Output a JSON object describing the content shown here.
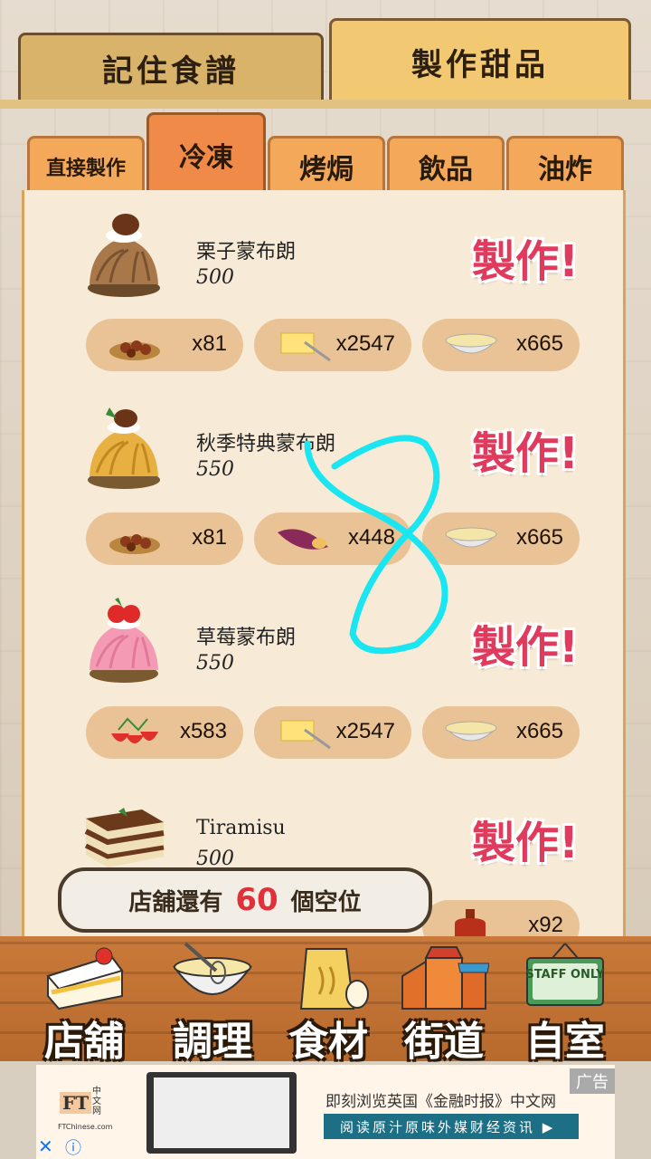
{
  "top_tabs": {
    "left": "記住食譜",
    "right": "製作甜品"
  },
  "category_tabs": [
    "直接製作",
    "冷凍",
    "烤焗",
    "飲品",
    "油炸"
  ],
  "recipes": [
    {
      "name": "栗子蒙布朗",
      "price": "500",
      "make_label": "製作!",
      "ingredients": [
        {
          "icon": "chestnut-icon",
          "count": "x81"
        },
        {
          "icon": "butter-icon",
          "count": "x2547"
        },
        {
          "icon": "cream-bowl-icon",
          "count": "x665"
        }
      ]
    },
    {
      "name": "秋季特典蒙布朗",
      "price": "550",
      "make_label": "製作!",
      "ingredients": [
        {
          "icon": "chestnut-icon",
          "count": "x81"
        },
        {
          "icon": "sweet-potato-icon",
          "count": "x448"
        },
        {
          "icon": "cream-bowl-icon",
          "count": "x665"
        }
      ]
    },
    {
      "name": "草莓蒙布朗",
      "price": "550",
      "make_label": "製作!",
      "ingredients": [
        {
          "icon": "strawberry-icon",
          "count": "x583"
        },
        {
          "icon": "butter-icon",
          "count": "x2547"
        },
        {
          "icon": "cream-bowl-icon",
          "count": "x665"
        }
      ]
    },
    {
      "name": "Tiramisu",
      "price": "500",
      "make_label": "製作!",
      "ingredients": [
        {
          "icon": "liquor-bottle-icon",
          "count": "x92"
        }
      ]
    }
  ],
  "seat_notice": {
    "prefix": "店舖還有",
    "count": "60",
    "suffix": "個空位"
  },
  "bottom_nav": [
    "店舖",
    "調理",
    "食材",
    "街道",
    "自室"
  ],
  "staff_sign": "STAFF ONLY",
  "ad": {
    "logo": "FT",
    "logo_cn": "中文网",
    "domain": "FTChinese.com",
    "headline": "即刻浏览英国《金融时报》中文网",
    "cta": "阅读原汁原味外媒财经资讯 ▶",
    "tag": "广告"
  }
}
